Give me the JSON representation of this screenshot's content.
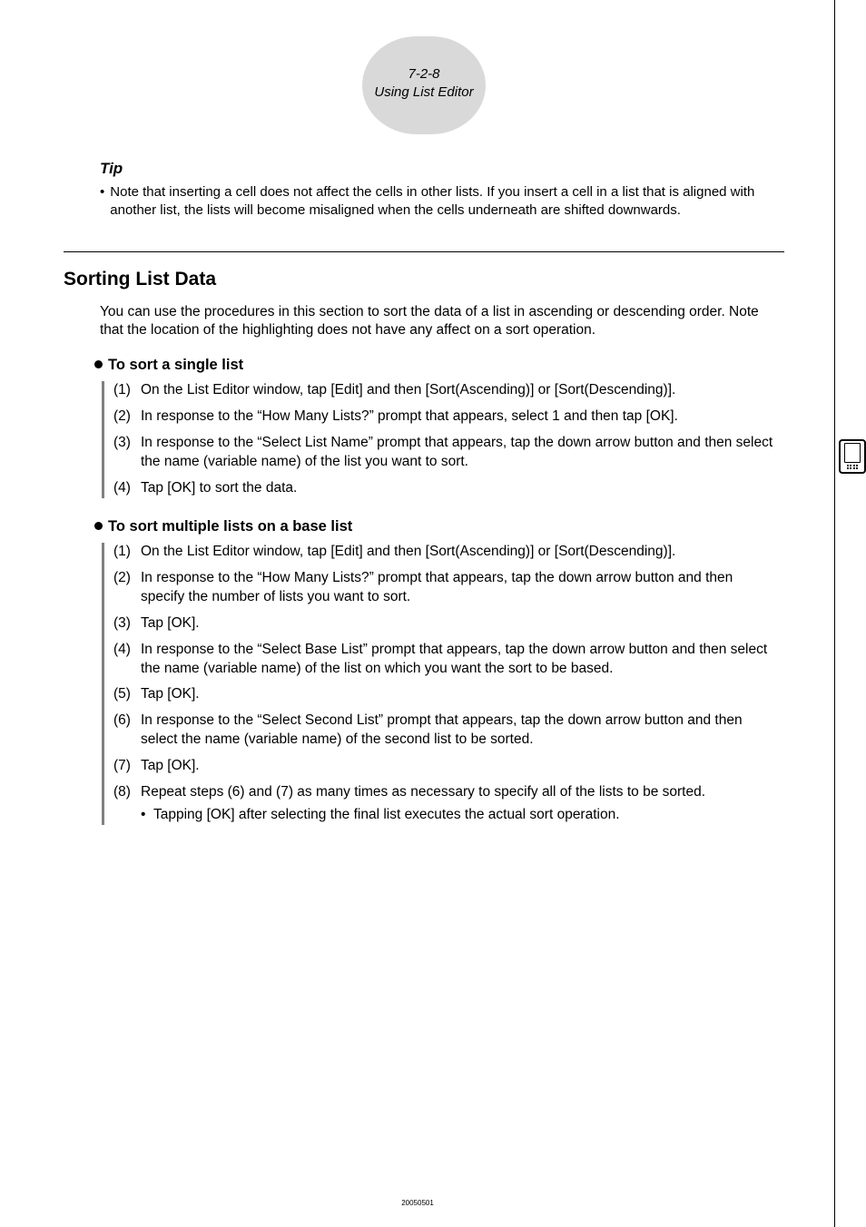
{
  "header": {
    "page_ref": "7-2-8",
    "section": "Using List Editor"
  },
  "tip": {
    "heading": "Tip",
    "body": "Note that inserting a cell does not affect the cells in other lists. If you insert a cell in a list that is aligned with another list, the lists will become misaligned when the cells underneath are shifted downwards."
  },
  "section": {
    "title": "Sorting List Data",
    "intro": "You can use the procedures in this section to sort the data of a list in ascending or descending order. Note that the location of the highlighting does not have any affect on a sort operation.",
    "sub1": {
      "title": "To sort a single list",
      "steps": [
        {
          "n": "(1)",
          "t": "On the List Editor window, tap [Edit] and then [Sort(Ascending)] or [Sort(Descending)]."
        },
        {
          "n": "(2)",
          "t": "In response to the “How Many Lists?” prompt that appears, select 1 and then tap [OK]."
        },
        {
          "n": "(3)",
          "t": "In response to the “Select List Name” prompt that appears, tap the down arrow button and then select the name (variable name) of the list you want to sort."
        },
        {
          "n": "(4)",
          "t": "Tap [OK] to sort the data."
        }
      ]
    },
    "sub2": {
      "title": "To sort multiple lists on a base list",
      "steps": [
        {
          "n": "(1)",
          "t": "On the List Editor window, tap [Edit] and then [Sort(Ascending)] or [Sort(Descending)]."
        },
        {
          "n": "(2)",
          "t": "In response to the “How Many Lists?” prompt that appears, tap the down arrow button and then specify the number of lists you want to sort."
        },
        {
          "n": "(3)",
          "t": "Tap [OK]."
        },
        {
          "n": "(4)",
          "t": "In response to the “Select Base List” prompt that appears, tap the down arrow button and then select the name (variable name) of the list on which you want the sort to be based."
        },
        {
          "n": "(5)",
          "t": "Tap [OK]."
        },
        {
          "n": "(6)",
          "t": "In response to the “Select Second List” prompt that appears, tap the down arrow button and then select the name (variable name) of the second list to be sorted."
        },
        {
          "n": "(7)",
          "t": "Tap [OK]."
        },
        {
          "n": "(8)",
          "t": "Repeat steps (6) and (7) as many times as necessary to specify all of the lists to be sorted.",
          "sub": "Tapping [OK] after selecting the final list executes the actual sort operation."
        }
      ]
    }
  },
  "footer": "20050501"
}
